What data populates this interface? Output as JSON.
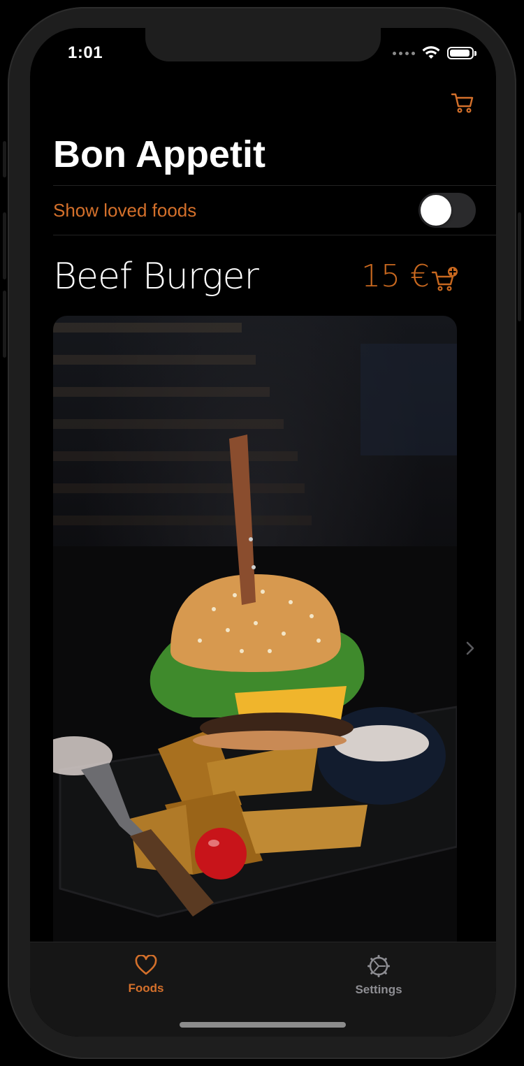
{
  "status_bar": {
    "time": "1:01"
  },
  "app": {
    "title": "Bon Appetit",
    "accent_color": "#d4702b",
    "nav_icon": "cart-icon"
  },
  "filter": {
    "label": "Show loved foods",
    "toggle_on": false
  },
  "food": {
    "name": "Beef Burger",
    "price": "15 €",
    "add_icon": "cart-add-icon",
    "image": "burger-with-potato-wedges-photo"
  },
  "tab_bar": {
    "items": [
      {
        "label": "Foods",
        "icon": "heart-icon",
        "selected": true
      },
      {
        "label": "Settings",
        "icon": "gear-icon",
        "selected": false
      }
    ]
  }
}
